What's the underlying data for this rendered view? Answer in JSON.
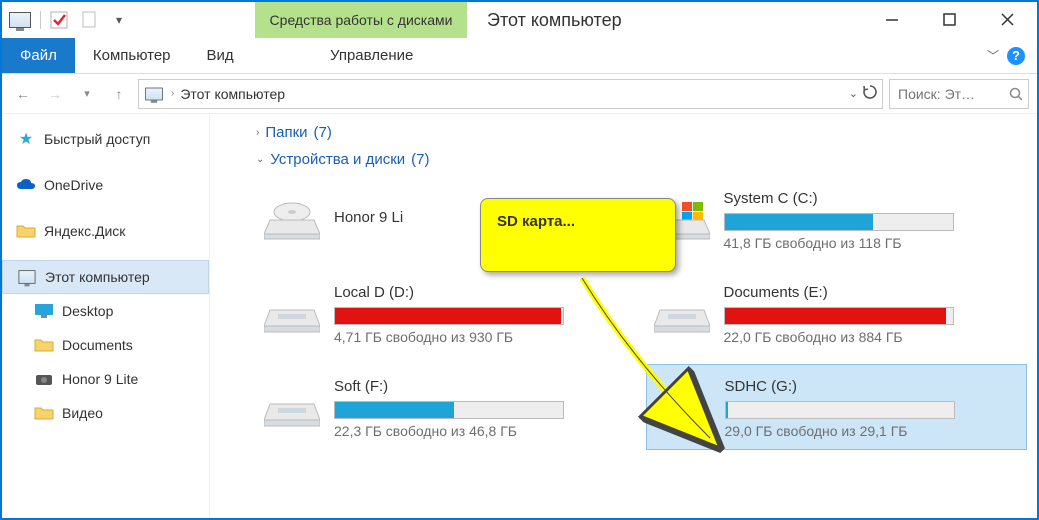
{
  "window": {
    "contextual_header": "Средства работы с дисками",
    "title": "Этот компьютер"
  },
  "ribbon": {
    "tabs": {
      "file": "Файл",
      "computer": "Компьютер",
      "view": "Вид",
      "manage": "Управление"
    }
  },
  "address": {
    "location": "Этот компьютер"
  },
  "search": {
    "placeholder": "Поиск: Эт…"
  },
  "nav": {
    "quick": "Быстрый доступ",
    "onedrive": "OneDrive",
    "yadisk": "Яндекс.Диск",
    "thispc": "Этот компьютер",
    "desktop": "Desktop",
    "documents": "Documents",
    "honor": "Honor 9 Lite",
    "video": "Видео"
  },
  "groups": {
    "folders": {
      "label": "Папки",
      "count": "(7)"
    },
    "drives": {
      "label": "Устройства и диски",
      "count": "(7)"
    }
  },
  "drives": {
    "honor": {
      "name": "Honor 9 Li",
      "free": "",
      "used_pct": 0,
      "color": "",
      "no_bar": true
    },
    "systemc": {
      "name": "System C (C:)",
      "free": "41,8 ГБ свободно из 118 ГБ",
      "used_pct": 65,
      "color": "#1fa4d8"
    },
    "locald": {
      "name": "Local D (D:)",
      "free": "4,71 ГБ свободно из 930 ГБ",
      "used_pct": 99,
      "color": "#e11212"
    },
    "docse": {
      "name": "Documents (E:)",
      "free": "22,0 ГБ свободно из 884 ГБ",
      "used_pct": 97,
      "color": "#e11212"
    },
    "softf": {
      "name": "Soft (F:)",
      "free": "22,3 ГБ свободно из 46,8 ГБ",
      "used_pct": 52,
      "color": "#1fa4d8"
    },
    "sdhcg": {
      "name": "SDHC (G:)",
      "free": "29,0 ГБ свободно из 29,1 ГБ",
      "used_pct": 1,
      "color": "#1fa4d8",
      "selected": true,
      "sd": true
    }
  },
  "callout": {
    "text": "SD карта..."
  }
}
